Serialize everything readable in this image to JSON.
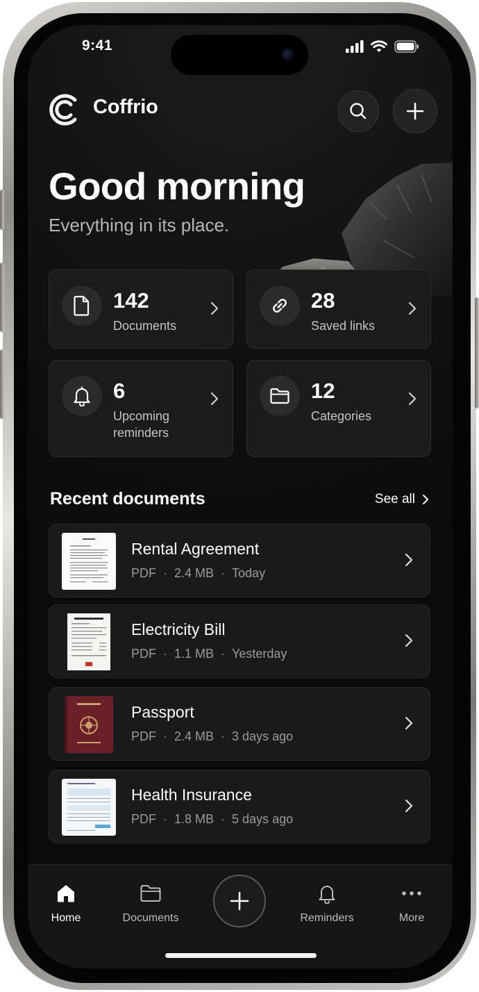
{
  "status": {
    "time": "9:41"
  },
  "header": {
    "brand": "Coffrio",
    "search_icon": "search-icon",
    "add_icon": "plus-icon"
  },
  "greeting": {
    "title": "Good morning",
    "subtitle": "Everything in its place."
  },
  "stats": [
    {
      "count": "142",
      "label": "Documents",
      "icon": "document-icon"
    },
    {
      "count": "28",
      "label": "Saved links",
      "icon": "link-icon"
    },
    {
      "count": "6",
      "label": "Upcoming reminders",
      "icon": "bell-icon"
    },
    {
      "count": "12",
      "label": "Categories",
      "icon": "folder-icon"
    }
  ],
  "recent": {
    "title": "Recent documents",
    "see_all": "See all",
    "items": [
      {
        "title": "Rental Agreement",
        "type": "PDF",
        "size": "2.4 MB",
        "date": "Today"
      },
      {
        "title": "Electricity Bill",
        "type": "PDF",
        "size": "1.1 MB",
        "date": "Yesterday"
      },
      {
        "title": "Passport",
        "type": "PDF",
        "size": "2.4 MB",
        "date": "3 days ago"
      },
      {
        "title": "Health Insurance",
        "type": "PDF",
        "size": "1.8 MB",
        "date": "5 days ago"
      }
    ]
  },
  "tabbar": {
    "home": "Home",
    "documents": "Documents",
    "reminders": "Reminders",
    "more": "More"
  },
  "colors": {
    "background": "#111111",
    "card": "#1b1b1b",
    "card_border": "#2c2c2c",
    "text": "#ffffff",
    "muted": "#9a9a9a",
    "passport": "#6b1f28"
  }
}
